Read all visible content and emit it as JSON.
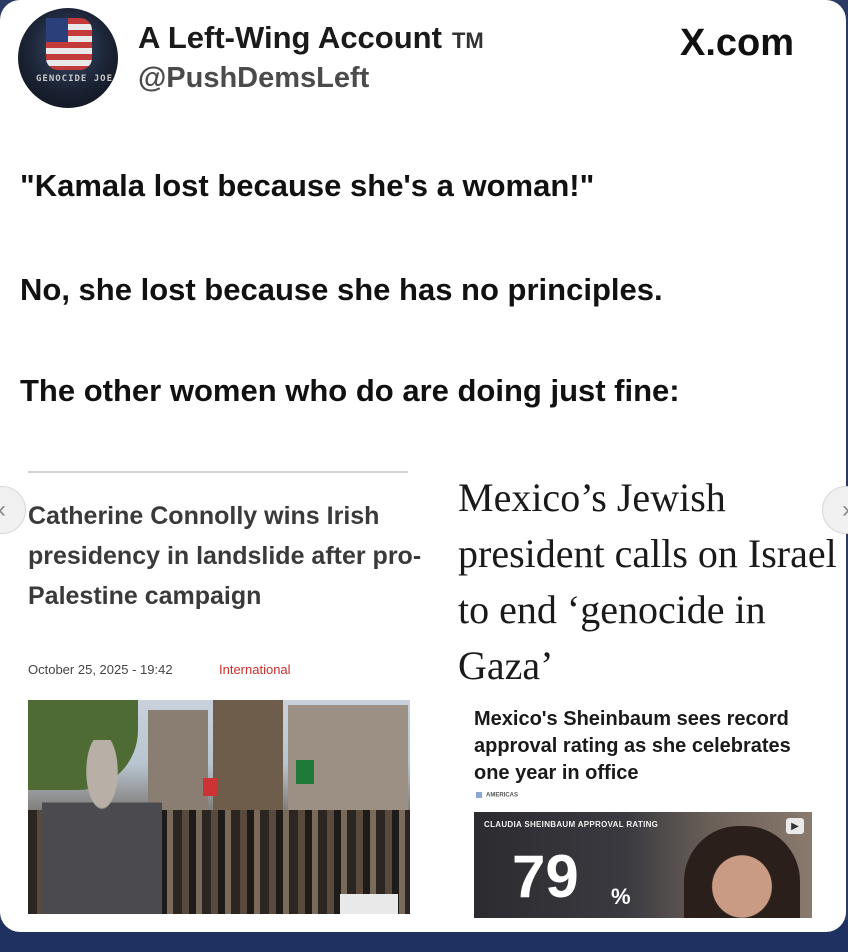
{
  "post": {
    "author_name": "A Left-Wing Account",
    "trademark": "TM",
    "handle": "@PushDemsLeft",
    "source_brand": "X.com",
    "avatar_text": "GENOCIDE JOE",
    "lines": [
      "\"Kamala lost because she's a woman!\"",
      "No, she lost because she has no principles.",
      "The other women who do are doing just fine:"
    ]
  },
  "irish_article": {
    "headline": "Catherine Connolly wins Irish presidency in landslide after pro-Palestine campaign",
    "date": "October 25, 2025 - 19:42",
    "category": "International"
  },
  "mexico_article": {
    "headline": "Mexico’s Jewish president calls on Israel to end ‘genocide in Gaza’",
    "subheadline": "Mexico's Sheinbaum sees record approval rating as she celebrates one year in office",
    "section_tag": "AMERICAS",
    "panel_title": "CLAUDIA SHEINBAUM APPROVAL RATING",
    "approval_number": "79",
    "approval_sign": "%"
  },
  "icons": {
    "prev": "chevron-left-icon",
    "next": "chevron-right-icon",
    "speaker": "speaker-icon"
  }
}
